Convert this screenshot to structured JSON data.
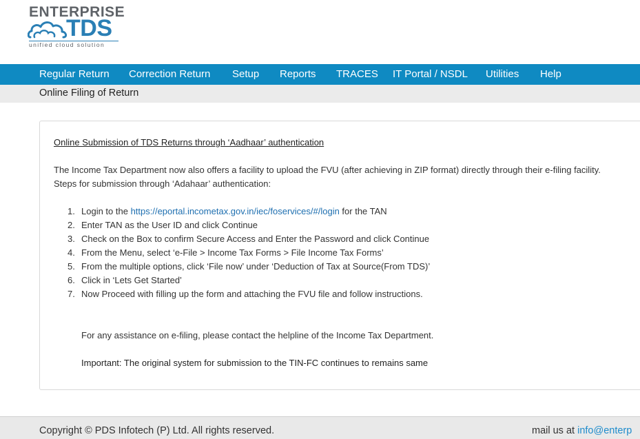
{
  "logo": {
    "top_text": "ENTERPRISE",
    "main_text": "TDS",
    "tagline": "unified cloud solution"
  },
  "nav": {
    "items": [
      {
        "label": "Regular Return"
      },
      {
        "label": "Correction Return"
      },
      {
        "label": "Setup"
      },
      {
        "label": "Reports"
      },
      {
        "label": "TRACES"
      },
      {
        "label": "IT Portal / NSDL"
      },
      {
        "label": "Utilities"
      },
      {
        "label": "Help"
      }
    ]
  },
  "subbar": {
    "title": "Online Filing of Return"
  },
  "content": {
    "heading": "Online Submission of TDS Returns through ‘Aadhaar’ authentication",
    "intro_line1": "The Income Tax Department now also offers a facility to upload the FVU (after achieving in ZIP format) directly through their e-filing facility.",
    "intro_line2": "Steps for submission through ‘Adahaar’ authentication:",
    "step1_prefix": "Login to the ",
    "step1_link": "https://eportal.incometax.gov.in/iec/foservices/#/login",
    "step1_suffix": " for the TAN",
    "steps": [
      {
        "num": "1.",
        "text": ""
      },
      {
        "num": "2.",
        "text": "Enter TAN as the User ID and click Continue"
      },
      {
        "num": "3.",
        "text": "Check on the Box to confirm Secure Access and Enter the Password and click Continue"
      },
      {
        "num": "4.",
        "text": "From the Menu, select ‘e-File > Income Tax Forms > File Income Tax Forms’"
      },
      {
        "num": "5.",
        "text": "From the multiple options, click ‘File now’ under ‘Deduction of Tax at Source(From TDS)’"
      },
      {
        "num": "6.",
        "text": "Click in ‘Lets Get Started’"
      },
      {
        "num": "7.",
        "text": "Now Proceed with filling up the form and attaching the FVU file and follow instructions."
      }
    ],
    "assistance": "For any assistance on e-filing, please contact the helpline of the Income Tax Department.",
    "important": "Important: The original system for submission to the TIN-FC continues to remains same"
  },
  "footer": {
    "copyright": "Copyright © PDS Infotech (P) Ltd. All rights reserved.",
    "mail_prefix": "mail us at ",
    "mail_link": "info@enterp"
  },
  "colors": {
    "nav_bg": "#0f8ac2",
    "brand_blue": "#2a7fb5",
    "link": "#1e6fb0"
  }
}
